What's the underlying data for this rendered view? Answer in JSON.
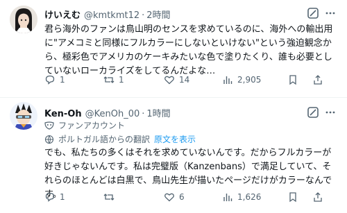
{
  "tweets": [
    {
      "name": "けいえむ",
      "handle": "@kmtkmt12",
      "separator": "·",
      "time": "2時間",
      "text": "君ら海外のファンは鳥山明のセンスを求めているのに、海外への輸出用に\"アメコミと同様にフルカラーにしないといけない\"という強迫観念から、極彩色でアメリカのケーキみたいな色で塗りたくり、誰も必要としていないローカライズをしてるんだよな…",
      "replies": "1",
      "retweets": "1",
      "likes": "14",
      "views": "2,905"
    },
    {
      "name": "Ken-Oh",
      "handle": "@KenOh_00",
      "separator": "·",
      "time": "1時間",
      "badge": "ファンアカウント",
      "translated_from": "ポルトガル語からの翻訳",
      "show_original": "原文を表示",
      "text": "でも、私たちの多くはそれを求めていないんです。だからフルカラーが好きじゃないんです。私は完璧版（Kanzenbans）で満足していて、それらのほとんどは白黒で、鳥山先生が描いたページだけがカラーなんです。",
      "replies": "1",
      "retweets": "",
      "likes": "6",
      "views": "1,626"
    }
  ],
  "icons": {
    "reply": "reply-icon",
    "retweet": "retweet-icon",
    "like": "heart-icon",
    "views": "views-icon",
    "bookmark": "bookmark-icon",
    "share": "share-icon",
    "grok": "grok-icon",
    "more": "more-icon",
    "fan": "mask-icon",
    "translate": "globe-icon"
  },
  "colors": {
    "text": "#0f1419",
    "muted": "#536471",
    "link": "#1d9bf0",
    "divider": "#eff3f4"
  }
}
